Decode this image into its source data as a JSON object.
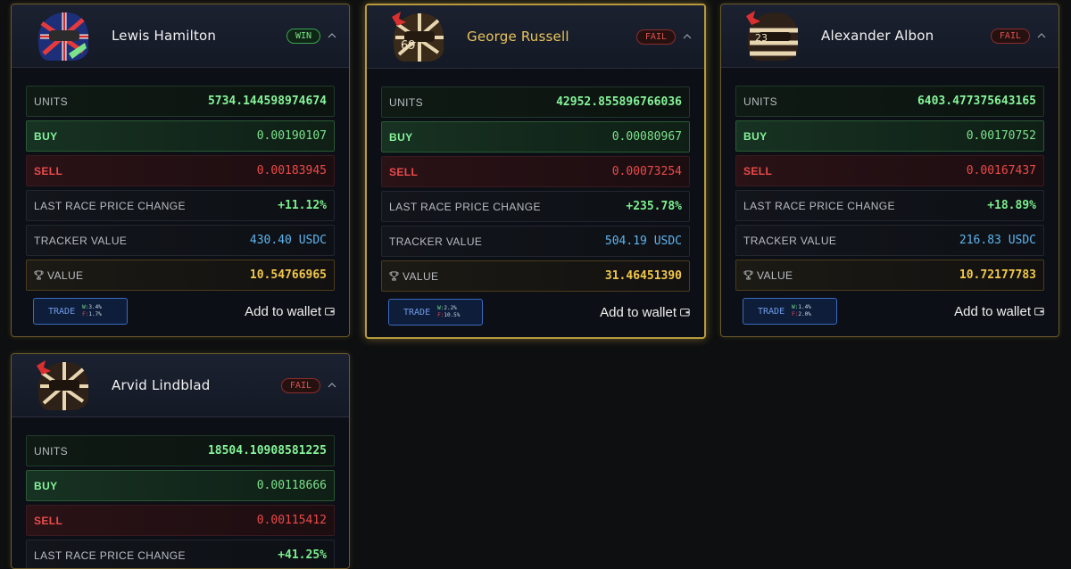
{
  "cards": [
    {
      "driver": "Lewis Hamilton",
      "status": "WIN",
      "units_label": "UNITS",
      "units": "5734.144598974674",
      "buy_label": "BUY",
      "buy": "0.00190107",
      "sell_label": "SELL",
      "sell": "0.00183945",
      "change_label": "LAST RACE PRICE CHANGE",
      "change": "+11.12%",
      "tracker_label": "TRACKER VALUE",
      "tracker": "430.40 USDC",
      "value_label": "VALUE",
      "value": "10.54766965",
      "trade_label": "TRADE",
      "trade_w": "3.4%",
      "trade_l": "1.7%",
      "wallet_label": "Add to wallet"
    },
    {
      "driver": "George Russell",
      "status": "FAIL",
      "units_label": "UNITS",
      "units": "42952.855896766036",
      "buy_label": "BUY",
      "buy": "0.00080967",
      "sell_label": "SELL",
      "sell": "0.00073254",
      "change_label": "LAST RACE PRICE CHANGE",
      "change": "+235.78%",
      "tracker_label": "TRACKER VALUE",
      "tracker": "504.19 USDC",
      "value_label": "VALUE",
      "value": "31.46451390",
      "trade_label": "TRADE",
      "trade_w": "2.2%",
      "trade_l": "10.5%",
      "wallet_label": "Add to wallet"
    },
    {
      "driver": "Alexander Albon",
      "status": "FAIL",
      "units_label": "UNITS",
      "units": "6403.477375643165",
      "buy_label": "BUY",
      "buy": "0.00170752",
      "sell_label": "SELL",
      "sell": "0.00167437",
      "change_label": "LAST RACE PRICE CHANGE",
      "change": "+18.89%",
      "tracker_label": "TRACKER VALUE",
      "tracker": "216.83 USDC",
      "value_label": "VALUE",
      "value": "10.72177783",
      "trade_label": "TRADE",
      "trade_w": "1.4%",
      "trade_l": "2.0%",
      "wallet_label": "Add to wallet"
    },
    {
      "driver": "Arvid Lindblad",
      "status": "FAIL",
      "units_label": "UNITS",
      "units": "18504.10908581225",
      "buy_label": "BUY",
      "buy": "0.00118666",
      "sell_label": "SELL",
      "sell": "0.00115412",
      "change_label": "LAST RACE PRICE CHANGE",
      "change": "+41.25%"
    }
  ],
  "trade_prefix_w": "W:",
  "trade_prefix_l": "F:",
  "colors": {
    "win": "#7be38a",
    "fail": "#d9534f",
    "gold": "#e9c45a",
    "accent": "#3a6bc0"
  },
  "icons": [
    "helmet-icon",
    "chevron-up-icon",
    "trophy-icon",
    "wallet-icon"
  ]
}
